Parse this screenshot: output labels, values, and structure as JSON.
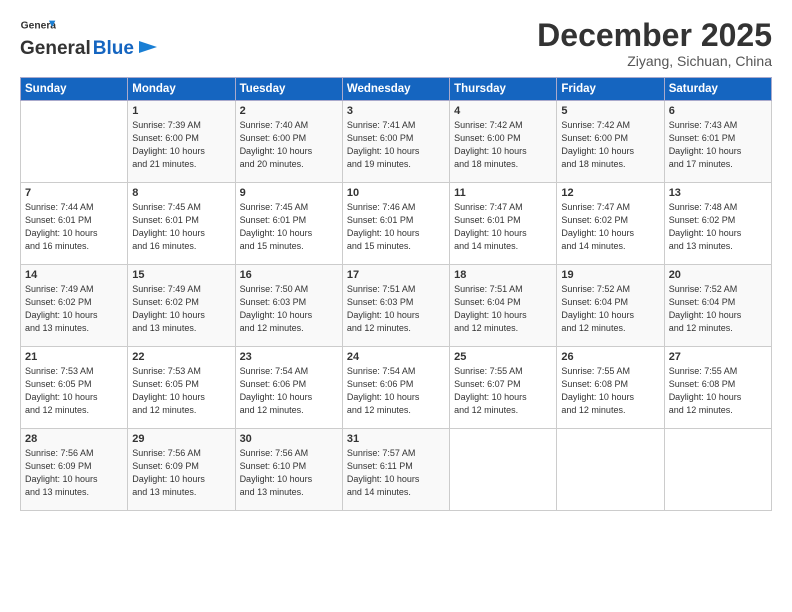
{
  "header": {
    "logo_line1": "General",
    "logo_line2": "Blue",
    "month": "December 2025",
    "location": "Ziyang, Sichuan, China"
  },
  "weekdays": [
    "Sunday",
    "Monday",
    "Tuesday",
    "Wednesday",
    "Thursday",
    "Friday",
    "Saturday"
  ],
  "weeks": [
    [
      {
        "num": "",
        "info": ""
      },
      {
        "num": "1",
        "info": "Sunrise: 7:39 AM\nSunset: 6:00 PM\nDaylight: 10 hours\nand 21 minutes."
      },
      {
        "num": "2",
        "info": "Sunrise: 7:40 AM\nSunset: 6:00 PM\nDaylight: 10 hours\nand 20 minutes."
      },
      {
        "num": "3",
        "info": "Sunrise: 7:41 AM\nSunset: 6:00 PM\nDaylight: 10 hours\nand 19 minutes."
      },
      {
        "num": "4",
        "info": "Sunrise: 7:42 AM\nSunset: 6:00 PM\nDaylight: 10 hours\nand 18 minutes."
      },
      {
        "num": "5",
        "info": "Sunrise: 7:42 AM\nSunset: 6:00 PM\nDaylight: 10 hours\nand 18 minutes."
      },
      {
        "num": "6",
        "info": "Sunrise: 7:43 AM\nSunset: 6:01 PM\nDaylight: 10 hours\nand 17 minutes."
      }
    ],
    [
      {
        "num": "7",
        "info": "Sunrise: 7:44 AM\nSunset: 6:01 PM\nDaylight: 10 hours\nand 16 minutes."
      },
      {
        "num": "8",
        "info": "Sunrise: 7:45 AM\nSunset: 6:01 PM\nDaylight: 10 hours\nand 16 minutes."
      },
      {
        "num": "9",
        "info": "Sunrise: 7:45 AM\nSunset: 6:01 PM\nDaylight: 10 hours\nand 15 minutes."
      },
      {
        "num": "10",
        "info": "Sunrise: 7:46 AM\nSunset: 6:01 PM\nDaylight: 10 hours\nand 15 minutes."
      },
      {
        "num": "11",
        "info": "Sunrise: 7:47 AM\nSunset: 6:01 PM\nDaylight: 10 hours\nand 14 minutes."
      },
      {
        "num": "12",
        "info": "Sunrise: 7:47 AM\nSunset: 6:02 PM\nDaylight: 10 hours\nand 14 minutes."
      },
      {
        "num": "13",
        "info": "Sunrise: 7:48 AM\nSunset: 6:02 PM\nDaylight: 10 hours\nand 13 minutes."
      }
    ],
    [
      {
        "num": "14",
        "info": "Sunrise: 7:49 AM\nSunset: 6:02 PM\nDaylight: 10 hours\nand 13 minutes."
      },
      {
        "num": "15",
        "info": "Sunrise: 7:49 AM\nSunset: 6:02 PM\nDaylight: 10 hours\nand 13 minutes."
      },
      {
        "num": "16",
        "info": "Sunrise: 7:50 AM\nSunset: 6:03 PM\nDaylight: 10 hours\nand 12 minutes."
      },
      {
        "num": "17",
        "info": "Sunrise: 7:51 AM\nSunset: 6:03 PM\nDaylight: 10 hours\nand 12 minutes."
      },
      {
        "num": "18",
        "info": "Sunrise: 7:51 AM\nSunset: 6:04 PM\nDaylight: 10 hours\nand 12 minutes."
      },
      {
        "num": "19",
        "info": "Sunrise: 7:52 AM\nSunset: 6:04 PM\nDaylight: 10 hours\nand 12 minutes."
      },
      {
        "num": "20",
        "info": "Sunrise: 7:52 AM\nSunset: 6:04 PM\nDaylight: 10 hours\nand 12 minutes."
      }
    ],
    [
      {
        "num": "21",
        "info": "Sunrise: 7:53 AM\nSunset: 6:05 PM\nDaylight: 10 hours\nand 12 minutes."
      },
      {
        "num": "22",
        "info": "Sunrise: 7:53 AM\nSunset: 6:05 PM\nDaylight: 10 hours\nand 12 minutes."
      },
      {
        "num": "23",
        "info": "Sunrise: 7:54 AM\nSunset: 6:06 PM\nDaylight: 10 hours\nand 12 minutes."
      },
      {
        "num": "24",
        "info": "Sunrise: 7:54 AM\nSunset: 6:06 PM\nDaylight: 10 hours\nand 12 minutes."
      },
      {
        "num": "25",
        "info": "Sunrise: 7:55 AM\nSunset: 6:07 PM\nDaylight: 10 hours\nand 12 minutes."
      },
      {
        "num": "26",
        "info": "Sunrise: 7:55 AM\nSunset: 6:08 PM\nDaylight: 10 hours\nand 12 minutes."
      },
      {
        "num": "27",
        "info": "Sunrise: 7:55 AM\nSunset: 6:08 PM\nDaylight: 10 hours\nand 12 minutes."
      }
    ],
    [
      {
        "num": "28",
        "info": "Sunrise: 7:56 AM\nSunset: 6:09 PM\nDaylight: 10 hours\nand 13 minutes."
      },
      {
        "num": "29",
        "info": "Sunrise: 7:56 AM\nSunset: 6:09 PM\nDaylight: 10 hours\nand 13 minutes."
      },
      {
        "num": "30",
        "info": "Sunrise: 7:56 AM\nSunset: 6:10 PM\nDaylight: 10 hours\nand 13 minutes."
      },
      {
        "num": "31",
        "info": "Sunrise: 7:57 AM\nSunset: 6:11 PM\nDaylight: 10 hours\nand 14 minutes."
      },
      {
        "num": "",
        "info": ""
      },
      {
        "num": "",
        "info": ""
      },
      {
        "num": "",
        "info": ""
      }
    ]
  ]
}
